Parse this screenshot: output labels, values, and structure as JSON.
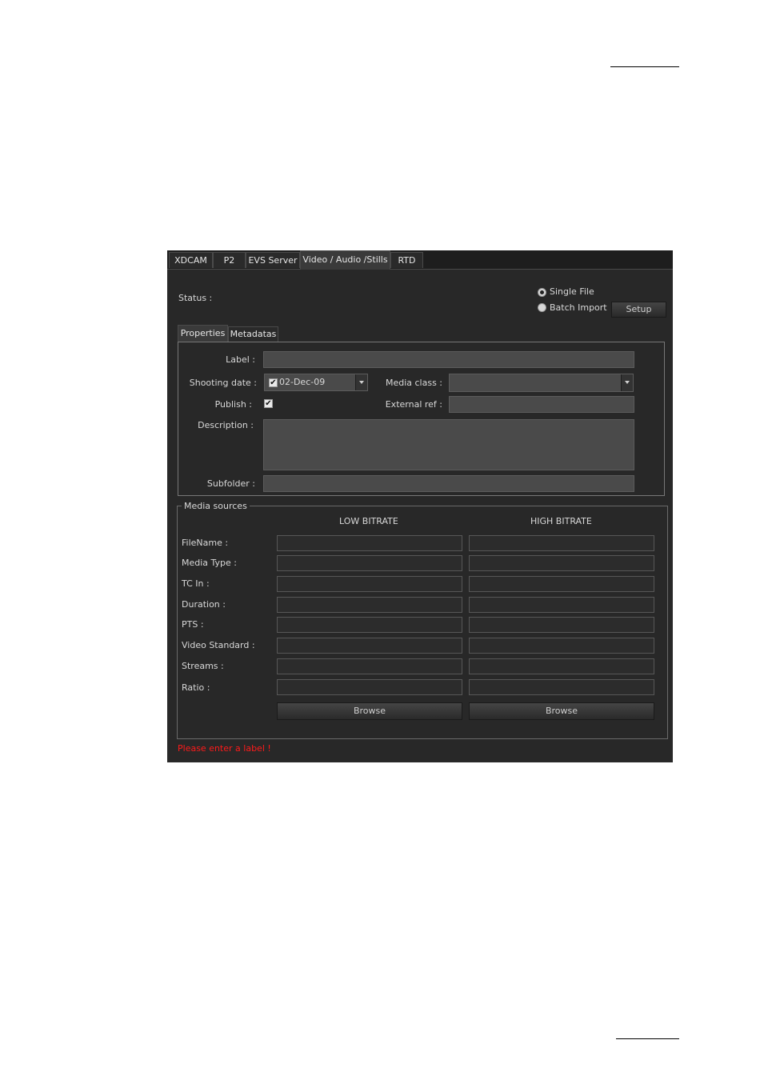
{
  "tabs": [
    "XDCAM",
    "P2",
    "EVS Server",
    "Video / Audio /Stills",
    "RTD"
  ],
  "status_label": "Status :",
  "import_mode": {
    "single_file": "Single File",
    "batch_import": "Batch Import",
    "selected": "Single File"
  },
  "setup_button": "Setup",
  "inner_tabs": [
    "Properties",
    "Metadatas"
  ],
  "properties": {
    "label_label": "Label :",
    "label_value": "",
    "shooting_date_label": "Shooting date :",
    "shooting_date_value": "02-Dec-09",
    "shooting_date_checked": true,
    "media_class_label": "Media class :",
    "media_class_value": "",
    "publish_label": "Publish :",
    "publish_checked": true,
    "external_ref_label": "External ref :",
    "external_ref_value": "",
    "description_label": "Description :",
    "description_value": "",
    "subfolder_label": "Subfolder :",
    "subfolder_value": ""
  },
  "media_sources": {
    "legend": "Media sources",
    "low_header": "LOW BITRATE",
    "high_header": "HIGH BITRATE",
    "rows": [
      {
        "label": "FileName :",
        "low": "",
        "high": ""
      },
      {
        "label": "Media Type :",
        "low": "",
        "high": ""
      },
      {
        "label": "TC In :",
        "low": "",
        "high": ""
      },
      {
        "label": "Duration :",
        "low": "",
        "high": ""
      },
      {
        "label": "PTS :",
        "low": "",
        "high": ""
      },
      {
        "label": "Video Standard :",
        "low": "",
        "high": ""
      },
      {
        "label": "Streams :",
        "low": "",
        "high": ""
      },
      {
        "label": "Ratio :",
        "low": "",
        "high": ""
      }
    ],
    "browse_low": "Browse",
    "browse_high": "Browse"
  },
  "error_message": "Please enter a label !",
  "colors": {
    "panel_bg": "#282828",
    "field_bg": "#4a4a4a",
    "error": "#ff1a1a"
  }
}
